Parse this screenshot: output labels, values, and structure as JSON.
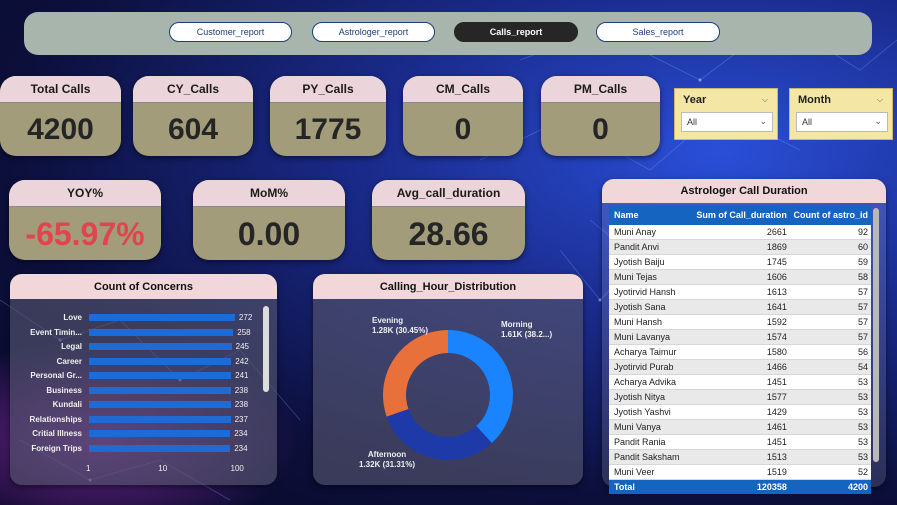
{
  "nav": {
    "tabs": [
      {
        "label": "Customer_report",
        "active": false
      },
      {
        "label": "Astrologer_report",
        "active": false
      },
      {
        "label": "Calls_report",
        "active": true
      },
      {
        "label": "Sales_report",
        "active": false
      }
    ]
  },
  "kpis": {
    "total_calls": {
      "label": "Total Calls",
      "value": "4200"
    },
    "cy_calls": {
      "label": "CY_Calls",
      "value": "604"
    },
    "py_calls": {
      "label": "PY_Calls",
      "value": "1775"
    },
    "cm_calls": {
      "label": "CM_Calls",
      "value": "0"
    },
    "pm_calls": {
      "label": "PM_Calls",
      "value": "0"
    },
    "yoy": {
      "label": "YOY%",
      "value": "-65.97%"
    },
    "mom": {
      "label": "MoM%",
      "value": "0.00"
    },
    "avg_duration": {
      "label": "Avg_call_duration",
      "value": "28.66"
    }
  },
  "slicers": {
    "year": {
      "title": "Year",
      "value": "All"
    },
    "month": {
      "title": "Month",
      "value": "All"
    }
  },
  "concerns": {
    "title": "Count of Concerns",
    "axis_ticks": [
      "1",
      "10",
      "100"
    ],
    "chart_data": {
      "type": "bar",
      "categories": [
        "Love",
        "Event Timin...",
        "Legal",
        "Career",
        "Personal Gr...",
        "Business",
        "Kundali",
        "Relationships",
        "Critial Illness",
        "Foreign Trips"
      ],
      "values": [
        272,
        258,
        245,
        242,
        241,
        238,
        238,
        237,
        234,
        234
      ],
      "xscale": "log",
      "xlim": [
        1,
        300
      ]
    }
  },
  "calling_hours": {
    "title": "Calling_Hour_Distribution",
    "chart_data": {
      "type": "pie",
      "labels": [
        "Morning",
        "Afternoon",
        "Evening"
      ],
      "values": [
        1610,
        1320,
        1280
      ],
      "label_text": [
        "1.61K (38.2...)",
        "1.32K (31.31%)",
        "1.28K (30.45%)"
      ],
      "colors": [
        "#1a84ff",
        "#1e3aa8",
        "#e8703a"
      ]
    }
  },
  "duration_table": {
    "title": "Astrologer Call Duration",
    "columns": [
      "Name",
      "Sum of Call_duration",
      "Count of astro_id"
    ],
    "rows": [
      [
        "Muni Anay",
        "2661",
        "92"
      ],
      [
        "Pandit Anvi",
        "1869",
        "60"
      ],
      [
        "Jyotish Baiju",
        "1745",
        "59"
      ],
      [
        "Muni Tejas",
        "1606",
        "58"
      ],
      [
        "Jyotirvid Hansh",
        "1613",
        "57"
      ],
      [
        "Jyotish Sana",
        "1641",
        "57"
      ],
      [
        "Muni Hansh",
        "1592",
        "57"
      ],
      [
        "Muni Lavanya",
        "1574",
        "57"
      ],
      [
        "Acharya Taimur",
        "1580",
        "56"
      ],
      [
        "Jyotirvid Purab",
        "1466",
        "54"
      ],
      [
        "Acharya Advika",
        "1451",
        "53"
      ],
      [
        "Jyotish Nitya",
        "1577",
        "53"
      ],
      [
        "Jyotish Yashvi",
        "1429",
        "53"
      ],
      [
        "Muni Vanya",
        "1461",
        "53"
      ],
      [
        "Pandit Rania",
        "1451",
        "53"
      ],
      [
        "Pandit Saksham",
        "1513",
        "53"
      ],
      [
        "Muni Veer",
        "1519",
        "52"
      ]
    ],
    "total": [
      "Total",
      "120358",
      "4200"
    ]
  },
  "colors": {
    "card_body": "#a29c7a",
    "card_header": "#ecd5da",
    "yoy_value": "#e0454d",
    "bar": "#1f6bd6",
    "table_header": "#1565c0"
  }
}
